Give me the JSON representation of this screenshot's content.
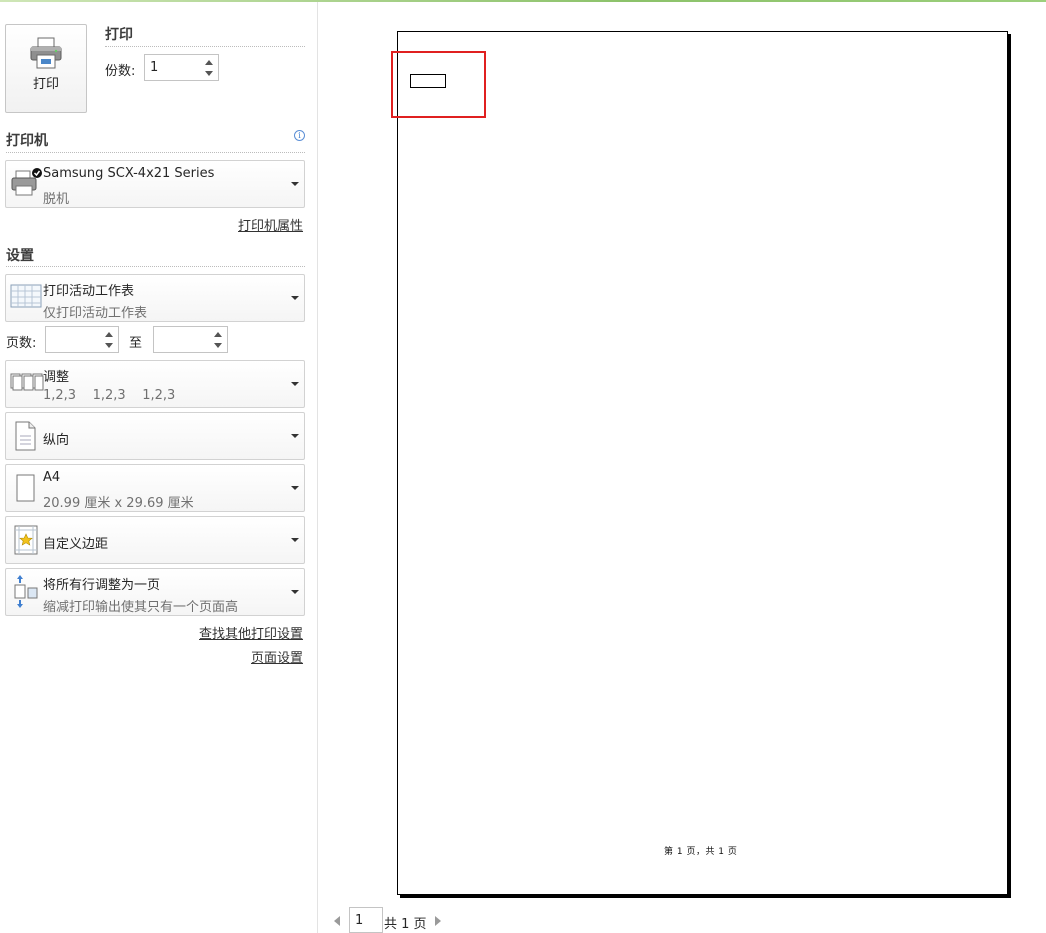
{
  "print_section": {
    "button_label": "打印",
    "title": "打印",
    "copies_label": "份数:",
    "copies_value": "1"
  },
  "printer_section": {
    "title": "打印机",
    "printer_name": "Samsung SCX-4x21 Series",
    "printer_status": "脱机",
    "properties_link": "打印机属性"
  },
  "settings_section": {
    "title": "设置",
    "scope": {
      "main": "打印活动工作表",
      "sub": "仅打印活动工作表"
    },
    "pages_label": "页数:",
    "pages_from": "",
    "pages_to_label": "至",
    "pages_to": "",
    "collate": {
      "main": "调整",
      "sub": "1,2,3    1,2,3    1,2,3"
    },
    "orientation": {
      "main": "纵向"
    },
    "paper": {
      "main": "A4",
      "sub": "20.99 厘米 x 29.69 厘米"
    },
    "margins": {
      "main": "自定义边距"
    },
    "scaling": {
      "main": "将所有行调整为一页",
      "sub": "缩减打印输出使其只有一个页面高"
    },
    "more_settings_link": "查找其他打印设置",
    "page_setup_link": "页面设置"
  },
  "preview": {
    "footer_text": "第 1 页，共 1 页",
    "current_page": "1",
    "total_pages_text": "共 1 页"
  },
  "colors": {
    "highlight": "#e02020",
    "accent_top": "#8cc26a"
  }
}
